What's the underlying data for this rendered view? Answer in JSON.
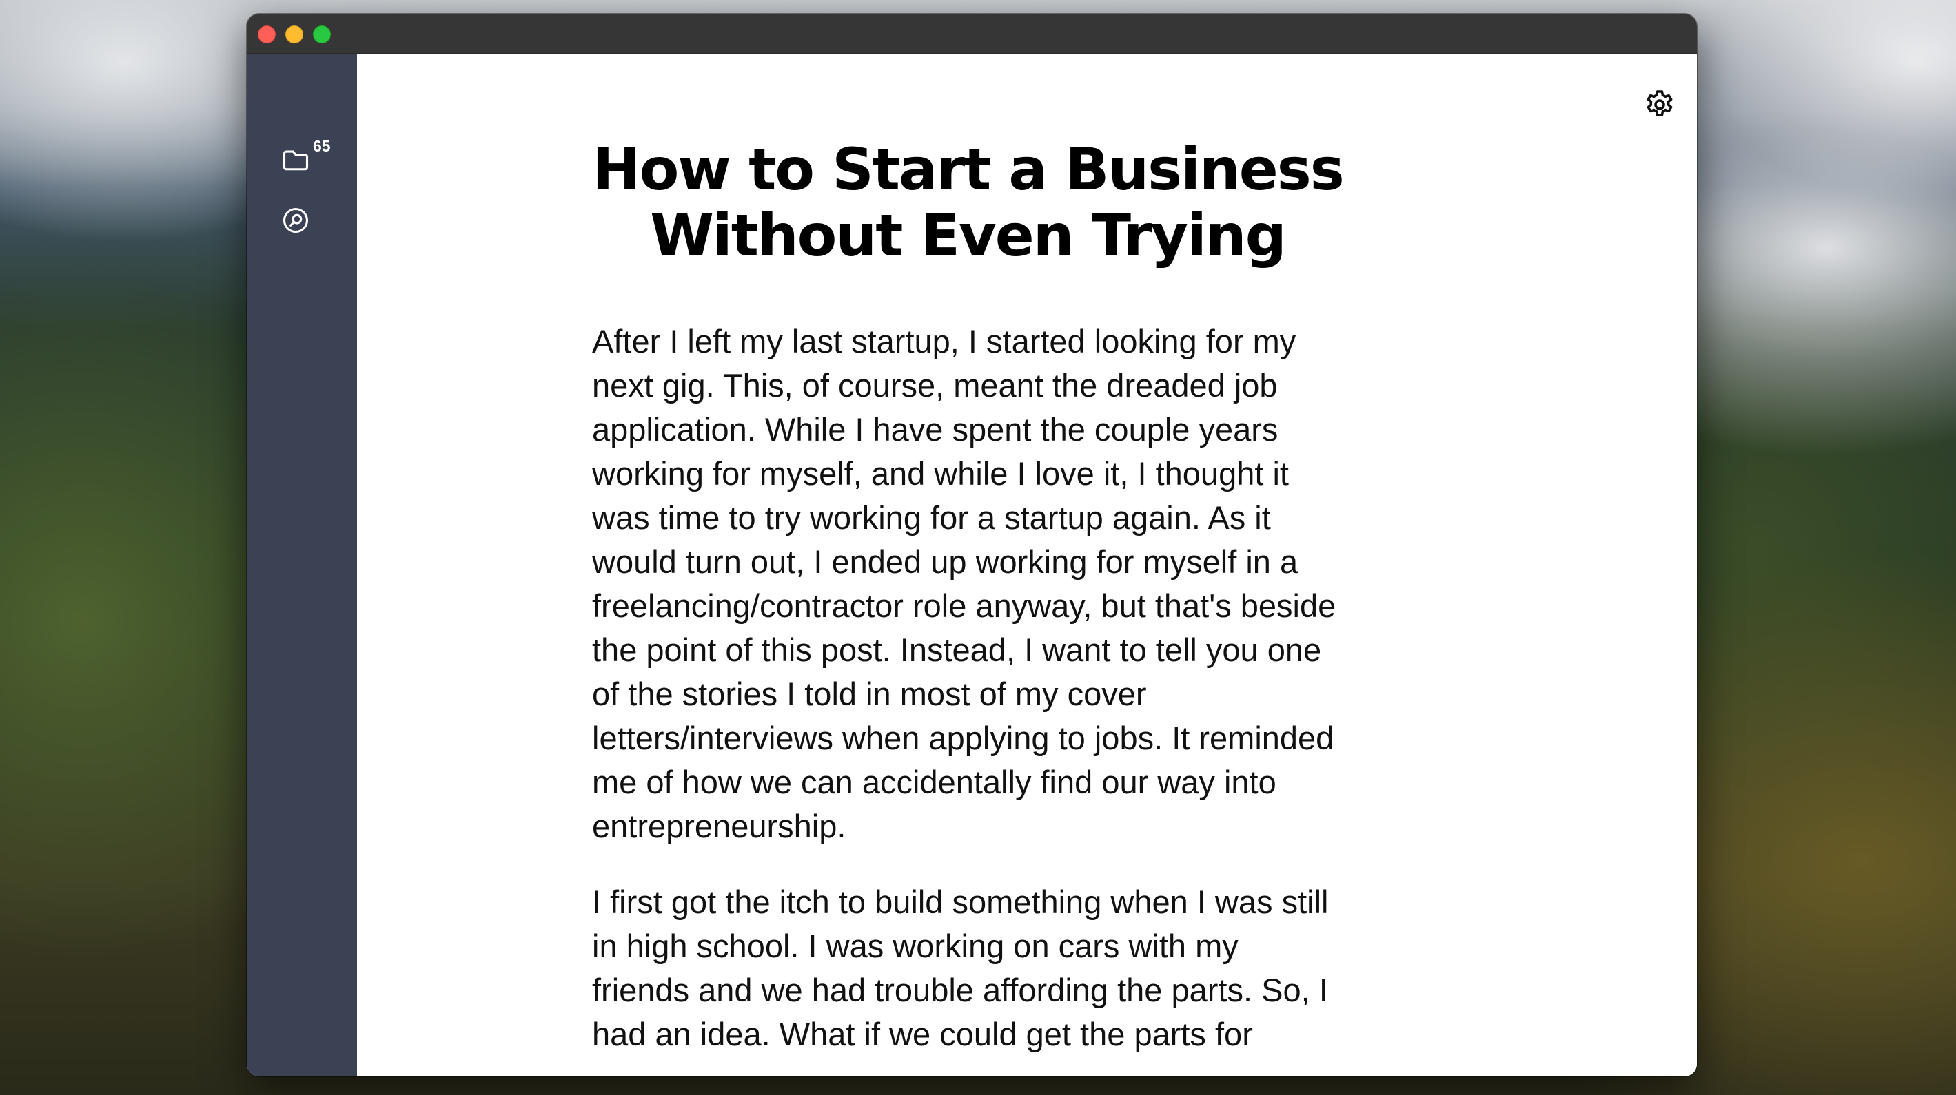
{
  "window": {
    "controls": [
      "close",
      "minimize",
      "maximize"
    ]
  },
  "sidebar": {
    "folder_icon": "folder-icon",
    "folder_count": "65",
    "search_icon": "search-icon"
  },
  "toolbar": {
    "settings_icon": "gear-icon"
  },
  "article": {
    "title_line1": "How to Start a Business",
    "title_line2": "Without Even Trying",
    "paragraphs": [
      "After I left my last startup, I started looking for my next gig. This, of course, meant the dreaded job application. While I have spent the couple years working for myself, and while I love it, I thought it was time to try working for a startup again. As it would turn out, I ended up working for myself in a freelancing/contractor role anyway, but that's beside the point of this post. Instead, I want to tell you one of the stories I told in most of my cover letters/interviews when applying to jobs. It reminded me of how we can accidentally find our way into entrepreneurship.",
      "I first got the itch to build something when I was still in high school. I was working on cars with my friends and we had trouble affording the parts. So, I had an idea. What if we could get the parts for"
    ]
  },
  "colors": {
    "titlebar": "#363636",
    "sidebar": "#3a4253",
    "content_bg": "#ffffff",
    "close": "#ff5f57",
    "minimize": "#febc2e",
    "maximize": "#28c840"
  }
}
